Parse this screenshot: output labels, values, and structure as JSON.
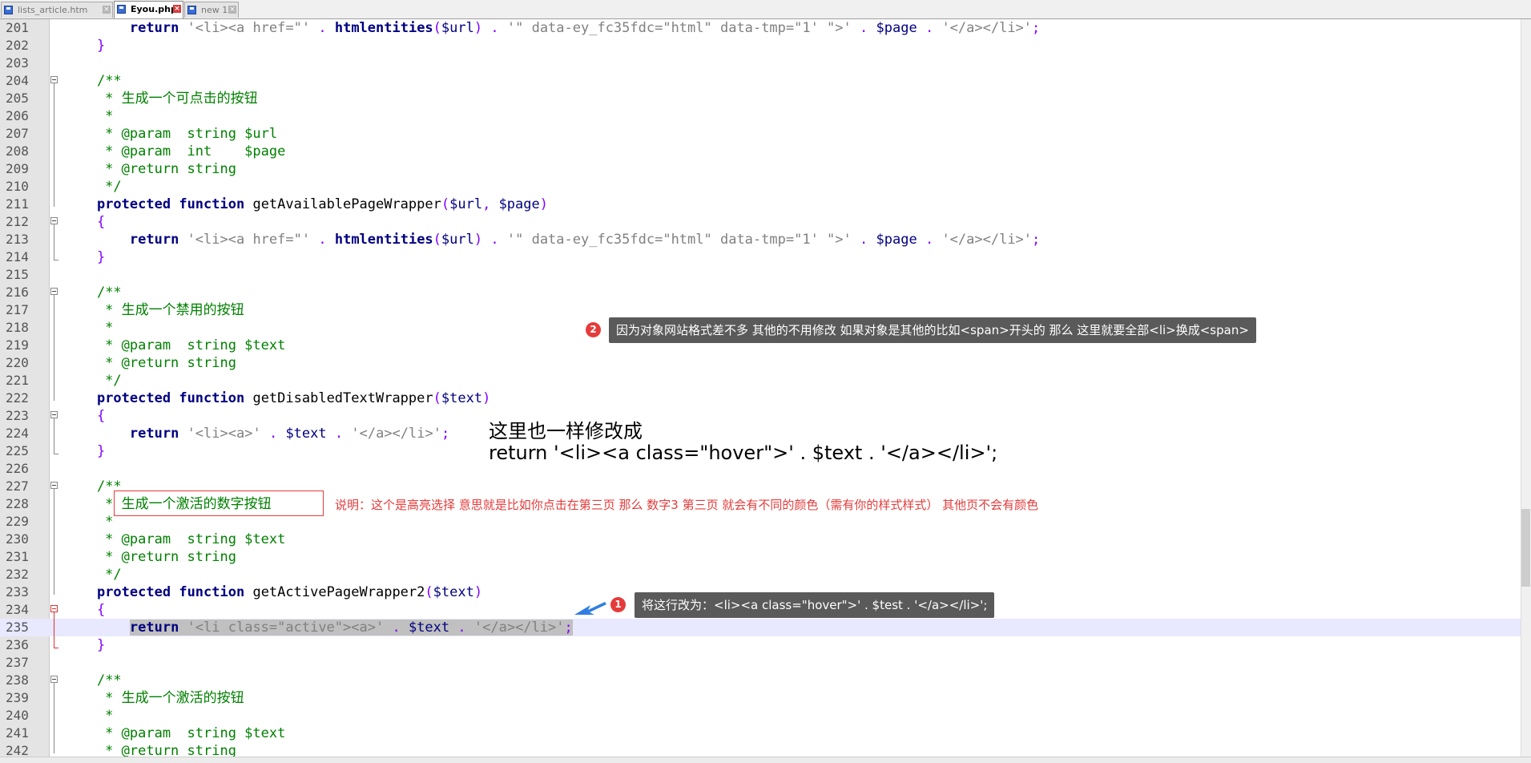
{
  "tabs": [
    {
      "label": "lists_article.htm",
      "active": false
    },
    {
      "label": "Eyou.php",
      "active": true
    },
    {
      "label": "new 1",
      "active": false
    }
  ],
  "lines": [
    {
      "num": "201",
      "parts": [
        [
          "pl",
          "        "
        ],
        [
          "kw",
          "return"
        ],
        [
          "pl",
          " "
        ],
        [
          "str",
          "'<li><a href=\"'"
        ],
        [
          "pl",
          " "
        ],
        [
          "op",
          "."
        ],
        [
          "pl",
          " "
        ],
        [
          "kw",
          "htmlentities"
        ],
        [
          "op",
          "("
        ],
        [
          "var",
          "$url"
        ],
        [
          "op",
          ")"
        ],
        [
          "pl",
          " "
        ],
        [
          "op",
          "."
        ],
        [
          "pl",
          " "
        ],
        [
          "str",
          "'\" data-ey_fc35fdc=\"html\" data-tmp=\"1' \">'"
        ],
        [
          "pl",
          " "
        ],
        [
          "op",
          "."
        ],
        [
          "pl",
          " "
        ],
        [
          "var",
          "$page"
        ],
        [
          "pl",
          " "
        ],
        [
          "op",
          "."
        ],
        [
          "pl",
          " "
        ],
        [
          "str",
          "'</a></li>'"
        ],
        [
          "op",
          ";"
        ]
      ]
    },
    {
      "num": "202",
      "parts": [
        [
          "pl",
          "    "
        ],
        [
          "op",
          "}"
        ]
      ]
    },
    {
      "num": "203",
      "parts": []
    },
    {
      "num": "204",
      "fold": "box",
      "parts": [
        [
          "pl",
          "    "
        ],
        [
          "cm",
          "/**"
        ]
      ]
    },
    {
      "num": "205",
      "parts": [
        [
          "cm",
          "     * 生成一个可点击的按钮"
        ]
      ]
    },
    {
      "num": "206",
      "parts": [
        [
          "cm",
          "     *"
        ]
      ]
    },
    {
      "num": "207",
      "parts": [
        [
          "cm",
          "     * @param  string $url"
        ]
      ]
    },
    {
      "num": "208",
      "parts": [
        [
          "cm",
          "     * @param  int    $page"
        ]
      ]
    },
    {
      "num": "209",
      "parts": [
        [
          "cm",
          "     * @return string"
        ]
      ]
    },
    {
      "num": "210",
      "parts": [
        [
          "cm",
          "     */"
        ]
      ]
    },
    {
      "num": "211",
      "parts": [
        [
          "pl",
          "    "
        ],
        [
          "kw",
          "protected"
        ],
        [
          "pl",
          " "
        ],
        [
          "kw",
          "function"
        ],
        [
          "pl",
          " getAvailablePageWrapper"
        ],
        [
          "op",
          "("
        ],
        [
          "var",
          "$url"
        ],
        [
          "op",
          ","
        ],
        [
          "pl",
          " "
        ],
        [
          "var",
          "$page"
        ],
        [
          "op",
          ")"
        ]
      ]
    },
    {
      "num": "212",
      "fold": "box",
      "parts": [
        [
          "pl",
          "    "
        ],
        [
          "op",
          "{"
        ]
      ]
    },
    {
      "num": "213",
      "parts": [
        [
          "pl",
          "        "
        ],
        [
          "kw",
          "return"
        ],
        [
          "pl",
          " "
        ],
        [
          "str",
          "'<li><a href=\"'"
        ],
        [
          "pl",
          " "
        ],
        [
          "op",
          "."
        ],
        [
          "pl",
          " "
        ],
        [
          "kw",
          "htmlentities"
        ],
        [
          "op",
          "("
        ],
        [
          "var",
          "$url"
        ],
        [
          "op",
          ")"
        ],
        [
          "pl",
          " "
        ],
        [
          "op",
          "."
        ],
        [
          "pl",
          " "
        ],
        [
          "str",
          "'\" data-ey_fc35fdc=\"html\" data-tmp=\"1' \">'"
        ],
        [
          "pl",
          " "
        ],
        [
          "op",
          "."
        ],
        [
          "pl",
          " "
        ],
        [
          "var",
          "$page"
        ],
        [
          "pl",
          " "
        ],
        [
          "op",
          "."
        ],
        [
          "pl",
          " "
        ],
        [
          "str",
          "'</a></li>'"
        ],
        [
          "op",
          ";"
        ]
      ]
    },
    {
      "num": "214",
      "parts": [
        [
          "pl",
          "    "
        ],
        [
          "op",
          "}"
        ]
      ]
    },
    {
      "num": "215",
      "parts": []
    },
    {
      "num": "216",
      "fold": "box",
      "parts": [
        [
          "pl",
          "    "
        ],
        [
          "cm",
          "/**"
        ]
      ]
    },
    {
      "num": "217",
      "parts": [
        [
          "cm",
          "     * 生成一个禁用的按钮"
        ]
      ]
    },
    {
      "num": "218",
      "parts": [
        [
          "cm",
          "     *"
        ]
      ]
    },
    {
      "num": "219",
      "parts": [
        [
          "cm",
          "     * @param  string $text"
        ]
      ]
    },
    {
      "num": "220",
      "parts": [
        [
          "cm",
          "     * @return string"
        ]
      ]
    },
    {
      "num": "221",
      "parts": [
        [
          "cm",
          "     */"
        ]
      ]
    },
    {
      "num": "222",
      "parts": [
        [
          "pl",
          "    "
        ],
        [
          "kw",
          "protected"
        ],
        [
          "pl",
          " "
        ],
        [
          "kw",
          "function"
        ],
        [
          "pl",
          " getDisabledTextWrapper"
        ],
        [
          "op",
          "("
        ],
        [
          "var",
          "$text"
        ],
        [
          "op",
          ")"
        ]
      ]
    },
    {
      "num": "223",
      "fold": "box",
      "parts": [
        [
          "pl",
          "    "
        ],
        [
          "op",
          "{"
        ]
      ]
    },
    {
      "num": "224",
      "parts": [
        [
          "pl",
          "        "
        ],
        [
          "kw",
          "return"
        ],
        [
          "pl",
          " "
        ],
        [
          "str",
          "'<li><a>'"
        ],
        [
          "pl",
          " "
        ],
        [
          "op",
          "."
        ],
        [
          "pl",
          " "
        ],
        [
          "var",
          "$text"
        ],
        [
          "pl",
          " "
        ],
        [
          "op",
          "."
        ],
        [
          "pl",
          " "
        ],
        [
          "str",
          "'</a></li>'"
        ],
        [
          "op",
          ";"
        ]
      ]
    },
    {
      "num": "225",
      "parts": [
        [
          "pl",
          "    "
        ],
        [
          "op",
          "}"
        ]
      ]
    },
    {
      "num": "226",
      "parts": []
    },
    {
      "num": "227",
      "fold": "box",
      "parts": [
        [
          "pl",
          "    "
        ],
        [
          "cm",
          "/**"
        ]
      ]
    },
    {
      "num": "228",
      "parts": [
        [
          "cm",
          "     * 生成一个激活的数字按钮"
        ]
      ]
    },
    {
      "num": "229",
      "parts": [
        [
          "cm",
          "     *"
        ]
      ]
    },
    {
      "num": "230",
      "parts": [
        [
          "cm",
          "     * @param  string $text"
        ]
      ]
    },
    {
      "num": "231",
      "parts": [
        [
          "cm",
          "     * @return string"
        ]
      ]
    },
    {
      "num": "232",
      "parts": [
        [
          "cm",
          "     */"
        ]
      ]
    },
    {
      "num": "233",
      "parts": [
        [
          "pl",
          "    "
        ],
        [
          "kw",
          "protected"
        ],
        [
          "pl",
          " "
        ],
        [
          "kw",
          "function"
        ],
        [
          "pl",
          " getActivePageWrapper2"
        ],
        [
          "op",
          "("
        ],
        [
          "var",
          "$text"
        ],
        [
          "op",
          ")"
        ]
      ]
    },
    {
      "num": "234",
      "fold": "red",
      "parts": [
        [
          "pl",
          "    "
        ],
        [
          "op",
          "{"
        ]
      ]
    },
    {
      "num": "235",
      "current": true,
      "parts": [
        [
          "pl",
          "        "
        ],
        [
          "kw sel",
          "return"
        ],
        [
          "pl sel",
          " "
        ],
        [
          "str sel",
          "'<li class=\"active\"><a>'"
        ],
        [
          "pl sel",
          " "
        ],
        [
          "op sel",
          "."
        ],
        [
          "pl sel",
          " "
        ],
        [
          "var sel",
          "$text"
        ],
        [
          "pl sel",
          " "
        ],
        [
          "op sel",
          "."
        ],
        [
          "pl sel",
          " "
        ],
        [
          "str sel",
          "'</a></li>'"
        ],
        [
          "op sel",
          ";"
        ]
      ]
    },
    {
      "num": "236",
      "parts": [
        [
          "pl",
          "    "
        ],
        [
          "op",
          "}"
        ]
      ]
    },
    {
      "num": "237",
      "parts": []
    },
    {
      "num": "238",
      "fold": "box",
      "parts": [
        [
          "pl",
          "    "
        ],
        [
          "cm",
          "/**"
        ]
      ]
    },
    {
      "num": "239",
      "parts": [
        [
          "cm",
          "     * 生成一个激活的按钮"
        ]
      ]
    },
    {
      "num": "240",
      "parts": [
        [
          "cm",
          "     *"
        ]
      ]
    },
    {
      "num": "241",
      "parts": [
        [
          "cm",
          "     * @param  string $text"
        ]
      ]
    },
    {
      "num": "242",
      "parts": [
        [
          "cm",
          "     * @return string"
        ]
      ]
    }
  ],
  "annotations": {
    "tip2_badge": "2",
    "tip2_text": "因为对象网站格式差不多 其他的不用修改 如果对象是其他的比如<span>开头的 那么 这里就要全部<li>换成<span>",
    "tip1_badge": "1",
    "tip1_text": "将这行改为：<li><a class=\"hover\">' . $test . '</a></li>';",
    "modify_line1": "这里也一样修改成",
    "modify_line2": " return '<li><a class=\"hover\">' . $text . '</a></li>';",
    "note_text": "说明：这个是高亮选择 意思就是比如你点击在第三页  那么 数字3  第三页 就会有不同的颜色（需有你的样式样式） 其他页不会有颜色"
  },
  "colors": {
    "keyword": "#000080",
    "string": "#808080",
    "operator": "#8000ff",
    "comment": "#008000",
    "annotation_red": "#e53b3b",
    "tooltip_bg": "#5a5a5a"
  }
}
